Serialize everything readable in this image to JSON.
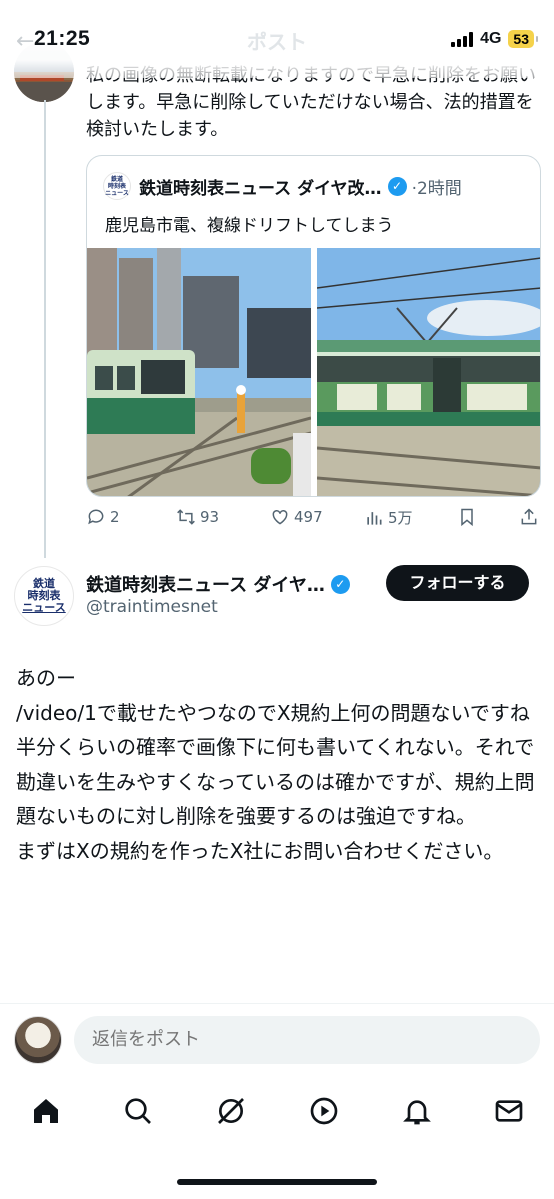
{
  "status": {
    "time": "21:25",
    "network": "4G",
    "battery": "53"
  },
  "nav": {
    "title": "ポスト"
  },
  "previous_tweet": {
    "text": "私の画像の無断転載になりますので早急に削除をお願いします。早急に削除していただけない場合、法的措置を検討いたします。"
  },
  "quoted_tweet": {
    "name": "鉄道時刻表ニュース ダイヤ改…",
    "time": "2時間",
    "text": "鹿児島市電、複線ドリフトしてしまう"
  },
  "actions": {
    "replies": "2",
    "reposts": "93",
    "likes": "497",
    "views": "5万"
  },
  "main_tweet": {
    "name": "鉄道時刻表ニュース ダイヤ…",
    "handle": "@traintimesnet",
    "follow_label": "フォローする",
    "avatar_line1": "鉄道",
    "avatar_line2": "時刻表",
    "avatar_line3": "ニュース",
    "lines": [
      "あのー",
      "/video/1で載せたやつなのでX規約上何の問題ないですね",
      "半分くらいの確率で画像下に何も書いてくれない。それで勘違いを生みやすくなっているのは確かですが、規約上問題ないものに対し削除を強要するのは強迫ですね。",
      "まずはXの規約を作ったX社にお問い合わせください。"
    ]
  },
  "reply": {
    "placeholder": "返信をポスト"
  },
  "tabs": [
    "home-icon",
    "search-icon",
    "grok-icon",
    "video-icon",
    "notifications-icon",
    "messages-icon"
  ],
  "colors": {
    "verified": "#1d9bf0",
    "text_secondary": "#536471",
    "battery": "#f5d24a"
  }
}
